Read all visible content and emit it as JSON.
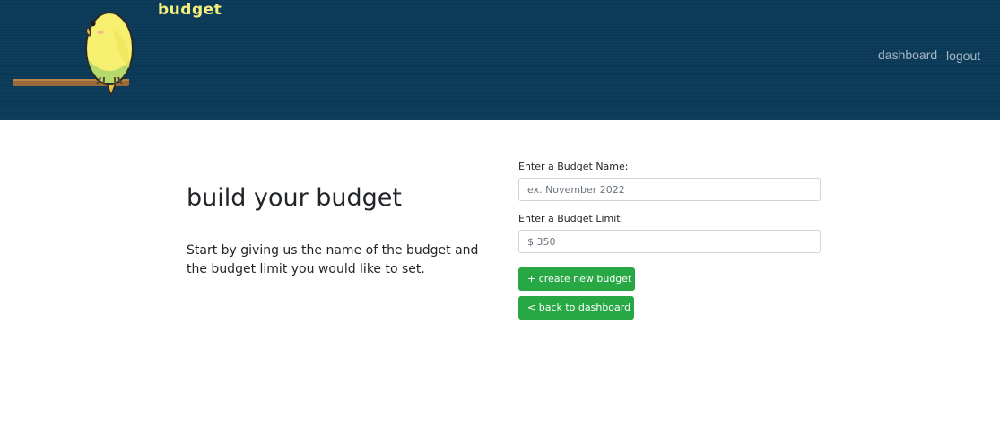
{
  "navbar": {
    "brand": "budget",
    "logo_icon": "parakeet-on-perch-icon",
    "links": [
      {
        "label": "dashboard"
      },
      {
        "label": "logout"
      }
    ],
    "colors": {
      "background": "#0b3a58",
      "brand": "#f6ef7a",
      "link": "#a8b6c2"
    }
  },
  "intro": {
    "title": "build your budget",
    "description": "Start by giving us the name of the budget and the budget limit you would like to set."
  },
  "form": {
    "name_label": "Enter a Budget Name:",
    "name_placeholder": "ex. November 2022",
    "limit_label": "Enter a Budget Limit:",
    "limit_placeholder": "$ 350",
    "create_button": "+ create new budget",
    "back_button": "< back to dashboard",
    "button_color": "#28a745"
  }
}
